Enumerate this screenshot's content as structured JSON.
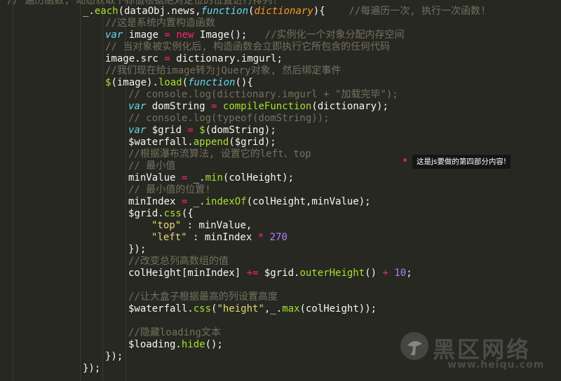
{
  "colors": {
    "background": "#272822",
    "default": "#f8f8f2",
    "comment": "#75715e",
    "keyword": "#66d9ef",
    "operator": "#f92672",
    "function": "#a6e22e",
    "string": "#e6db74",
    "number": "#ae81ff",
    "param": "#fd971f"
  },
  "editor": {
    "lines": [
      {
        "tokens": [
          [
            "c",
            "// 遍历函数, 动态获取下标值根据绝对定位的位置进行排列!"
          ]
        ]
      },
      {
        "tokens": [
          [
            "p",
            "_."
          ],
          [
            "f",
            "each"
          ],
          [
            "p",
            "(dataObj.news,"
          ],
          [
            "ki",
            "function"
          ],
          [
            "p",
            "("
          ],
          [
            "a",
            "dictionary"
          ],
          [
            "p",
            "){    "
          ],
          [
            "c",
            "//每遍历一次, 执行一次函数!"
          ]
        ]
      },
      {
        "tokens": [
          [
            "c",
            "//这是系统内置构造函数"
          ]
        ]
      },
      {
        "tokens": [
          [
            "ki",
            "var"
          ],
          [
            "p",
            " image "
          ],
          [
            "o",
            "="
          ],
          [
            "p",
            " "
          ],
          [
            "o",
            "new"
          ],
          [
            "p",
            " Image();   "
          ],
          [
            "c",
            "//实例化一个对象分配内存空间"
          ]
        ]
      },
      {
        "tokens": [
          [
            "c",
            "// 当对象被实例化后, 构造函数会立即执行它所包含的任何代码"
          ]
        ]
      },
      {
        "tokens": [
          [
            "p",
            "image.src "
          ],
          [
            "o",
            "="
          ],
          [
            "p",
            " dictionary.imgurl;"
          ]
        ]
      },
      {
        "tokens": [
          [
            "c",
            "//我们现在给image转为jQuery对象, 然后绑定事件"
          ]
        ]
      },
      {
        "tokens": [
          [
            "f",
            "$"
          ],
          [
            "p",
            "(image)."
          ],
          [
            "f",
            "load"
          ],
          [
            "p",
            "("
          ],
          [
            "ki",
            "function"
          ],
          [
            "p",
            "(){"
          ]
        ]
      },
      {
        "tokens": [
          [
            "c",
            "// console.log(dictionary.imgurl + \"加载完毕\");"
          ]
        ]
      },
      {
        "tokens": [
          [
            "ki",
            "var"
          ],
          [
            "p",
            " domString "
          ],
          [
            "o",
            "="
          ],
          [
            "p",
            " "
          ],
          [
            "f",
            "compileFunction"
          ],
          [
            "p",
            "(dictionary);"
          ]
        ]
      },
      {
        "tokens": [
          [
            "c",
            "// console.log(typeof(domString));"
          ]
        ]
      },
      {
        "tokens": [
          [
            "ki",
            "var"
          ],
          [
            "p",
            " $grid "
          ],
          [
            "o",
            "="
          ],
          [
            "p",
            " "
          ],
          [
            "f",
            "$"
          ],
          [
            "p",
            "(domString);"
          ]
        ]
      },
      {
        "tokens": [
          [
            "p",
            "$waterfall."
          ],
          [
            "f",
            "append"
          ],
          [
            "p",
            "($grid);"
          ]
        ]
      },
      {
        "tokens": [
          [
            "c",
            "//根据瀑布流算法, 设置它的left、top"
          ]
        ]
      },
      {
        "tokens": [
          [
            "c",
            "// 最小值"
          ]
        ]
      },
      {
        "tokens": [
          [
            "p",
            "minValue "
          ],
          [
            "o",
            "="
          ],
          [
            "p",
            " _."
          ],
          [
            "f",
            "min"
          ],
          [
            "p",
            "(colHeight);"
          ]
        ]
      },
      {
        "tokens": [
          [
            "c",
            "// 最小值的位置!"
          ]
        ]
      },
      {
        "tokens": [
          [
            "p",
            "minIndex "
          ],
          [
            "o",
            "="
          ],
          [
            "p",
            " _."
          ],
          [
            "f",
            "indexOf"
          ],
          [
            "p",
            "(colHeight,minValue);"
          ]
        ]
      },
      {
        "tokens": [
          [
            "p",
            "$grid."
          ],
          [
            "f",
            "css"
          ],
          [
            "p",
            "({"
          ]
        ]
      },
      {
        "tokens": [
          [
            "s",
            "\"top\""
          ],
          [
            "p",
            " : minValue,"
          ]
        ]
      },
      {
        "tokens": [
          [
            "s",
            "\"left\""
          ],
          [
            "p",
            " : minIndex "
          ],
          [
            "o",
            "*"
          ],
          [
            "p",
            " "
          ],
          [
            "n",
            "270"
          ]
        ]
      },
      {
        "tokens": [
          [
            "p",
            "});"
          ]
        ]
      },
      {
        "tokens": [
          [
            "c",
            "//改变总列高数组的值"
          ]
        ]
      },
      {
        "tokens": [
          [
            "p",
            "colHeight[minIndex] "
          ],
          [
            "o",
            "+="
          ],
          [
            "p",
            " $grid."
          ],
          [
            "f",
            "outerHeight"
          ],
          [
            "p",
            "() "
          ],
          [
            "o",
            "+"
          ],
          [
            "p",
            " "
          ],
          [
            "n",
            "10"
          ],
          [
            "p",
            ";"
          ]
        ]
      },
      {
        "tokens": []
      },
      {
        "tokens": [
          [
            "c",
            "//让大盒子根据最高的列设置高度"
          ]
        ]
      },
      {
        "tokens": [
          [
            "p",
            "$waterfall."
          ],
          [
            "f",
            "css"
          ],
          [
            "p",
            "("
          ],
          [
            "s",
            "\"height\""
          ],
          [
            "p",
            ",_."
          ],
          [
            "f",
            "max"
          ],
          [
            "p",
            "(colHeight));"
          ]
        ]
      },
      {
        "tokens": []
      },
      {
        "tokens": [
          [
            "c",
            "//隐藏loading文本"
          ]
        ]
      },
      {
        "tokens": [
          [
            "p",
            "$loading."
          ],
          [
            "f",
            "hide"
          ],
          [
            "p",
            "();"
          ]
        ]
      },
      {
        "tokens": [
          [
            "p",
            "});"
          ]
        ]
      },
      {
        "tokens": [
          [
            "p",
            "});"
          ]
        ]
      }
    ]
  },
  "annotation": {
    "text": "这是js要做的第四部分内容!"
  },
  "watermark": {
    "title": "黑区网络",
    "url": "www.heiqu.com",
    "logo_icon": "mushroom-logo-icon"
  }
}
